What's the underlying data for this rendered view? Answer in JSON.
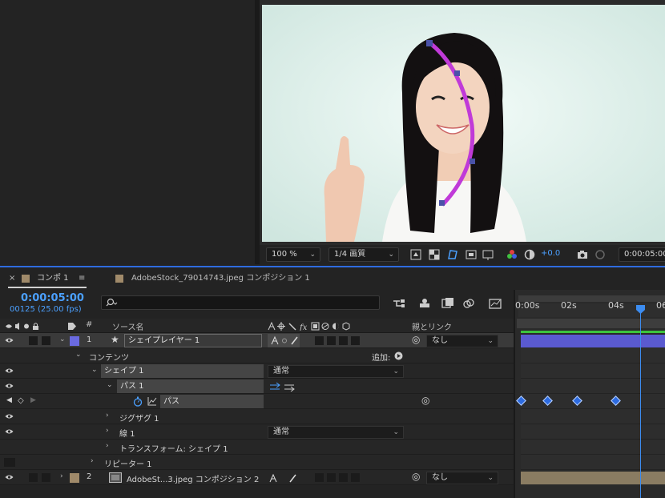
{
  "viewer": {
    "zoom": "100 %",
    "resolution": "1/4 画質",
    "exposure": "+0.0",
    "time": "0:00:05:00"
  },
  "timeline": {
    "tabs": [
      {
        "label": "コンポ 1",
        "close": "×",
        "menu": "≡",
        "color": "#a08a6a"
      },
      {
        "label": "AdobeStock_79014743.jpeg コンポジション 1",
        "color": "#a08a6a"
      }
    ],
    "timecode": "0:00:05:00",
    "frames": "00125 (25.00 fps)",
    "search_placeholder": "",
    "columns": {
      "number": "#",
      "source_name": "ソース名",
      "parent_link": "親とリンク"
    },
    "ruler": [
      "0:00s",
      "02s",
      "04s",
      "06"
    ],
    "add_label": "追加:",
    "layers": [
      {
        "index": "1",
        "name": "シェイプレイヤー 1",
        "parent": "なし",
        "color": "#6a6ae0"
      },
      {
        "index": "2",
        "name": "AdobeSt...3.jpeg コンポジション 2",
        "parent": "なし",
        "color": "#a08a6a"
      }
    ],
    "tree": {
      "contents": "コンテンツ",
      "shape": "シェイプ 1",
      "shape_mode": "通常",
      "path_group": "パス 1",
      "path": "パス",
      "zigzag": "ジグザグ 1",
      "stroke": "線 1",
      "stroke_mode": "通常",
      "transform": "トランスフォーム: シェイプ 1",
      "repeater": "リピーター 1"
    }
  }
}
